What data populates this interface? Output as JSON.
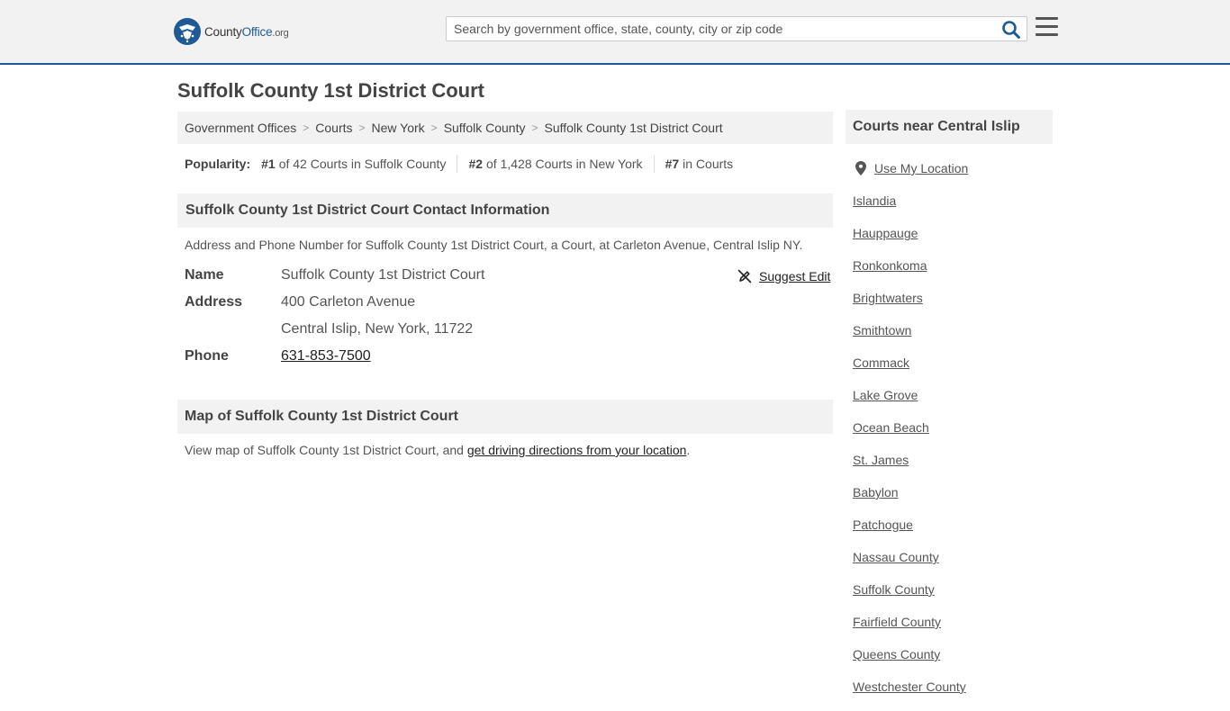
{
  "header": {
    "logo": {
      "name_part1": "County",
      "name_part2": "Office",
      "tld": ".org"
    },
    "search": {
      "placeholder": "Search by government office, state, county, city or zip code",
      "value": ""
    }
  },
  "page": {
    "title": "Suffolk County 1st District Court",
    "breadcrumb": [
      "Government Offices",
      "Courts",
      "New York",
      "Suffolk County",
      "Suffolk County 1st District Court"
    ],
    "popularity": {
      "label": "Popularity:",
      "items": [
        {
          "rank": "#1",
          "text": "of 42 Courts in Suffolk County"
        },
        {
          "rank": "#2",
          "text": "of 1,428 Courts in New York"
        },
        {
          "rank": "#7",
          "text": "in Courts"
        }
      ]
    }
  },
  "contact": {
    "heading": "Suffolk County 1st District Court Contact Information",
    "description": "Address and Phone Number for Suffolk County 1st District Court, a Court, at Carleton Avenue, Central Islip NY.",
    "suggest_edit": "Suggest Edit",
    "name_label": "Name",
    "name_value": "Suffolk County 1st District Court",
    "address_label": "Address",
    "address_line1": "400 Carleton Avenue",
    "address_line2": "Central Islip, New York, 11722",
    "phone_label": "Phone",
    "phone_value": "631-853-7500"
  },
  "map": {
    "heading": "Map of Suffolk County 1st District Court",
    "description_prefix": "View map of Suffolk County 1st District Court, and ",
    "directions_link": "get driving directions from your location",
    "description_suffix": "."
  },
  "sidebar": {
    "heading": "Courts near Central Islip",
    "use_location": "Use My Location",
    "items": [
      "Islandia",
      "Hauppauge",
      "Ronkonkoma",
      "Brightwaters",
      "Smithtown",
      "Commack",
      "Lake Grove",
      "Ocean Beach",
      "St. James",
      "Babylon",
      "Patchogue",
      "Nassau County",
      "Suffolk County",
      "Fairfield County",
      "Queens County",
      "Westchester County"
    ]
  },
  "colors": {
    "brand_blue": "#1e5a96",
    "header_bg": "#f2f2f2",
    "section_bg": "#f2f2f2"
  },
  "icons": [
    "county-office-seal-icon",
    "search-icon",
    "hamburger-menu-icon",
    "suggest-edit-icon",
    "location-pin-icon"
  ]
}
